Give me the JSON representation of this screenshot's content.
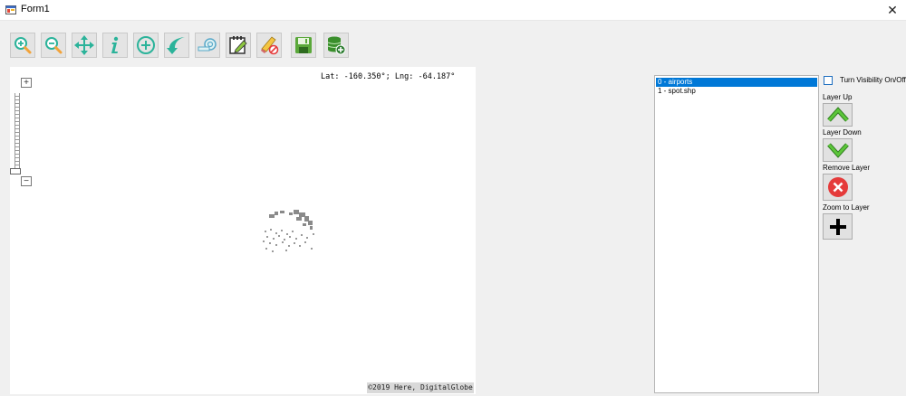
{
  "window": {
    "title": "Form1",
    "close_glyph": "✕",
    "app_icon": "form-app-icon"
  },
  "toolbar": {
    "buttons": [
      {
        "name": "zoom-in",
        "icon": "zoom-in-icon"
      },
      {
        "name": "zoom-out",
        "icon": "zoom-out-icon"
      },
      {
        "name": "pan",
        "icon": "pan-arrows-icon"
      },
      {
        "name": "info",
        "icon": "info-icon"
      },
      {
        "name": "add-layer",
        "icon": "plus-circle-icon"
      },
      {
        "name": "back",
        "icon": "back-arrow-icon"
      },
      {
        "name": "measure",
        "icon": "measure-tape-icon"
      },
      {
        "name": "edit",
        "icon": "edit-pencil-icon"
      },
      {
        "name": "clear",
        "icon": "eraser-icon"
      },
      {
        "name": "save",
        "icon": "floppy-save-icon"
      },
      {
        "name": "database-add",
        "icon": "database-add-icon"
      }
    ]
  },
  "map": {
    "coords_text": "Lat: -160.350°; Lng: -64.187°",
    "attribution": "©2019 Here, DigitalGlobe",
    "zoom_in_glyph": "+",
    "zoom_out_glyph": "−"
  },
  "layers": {
    "items": [
      "0 - airports",
      "1 - spot.shp"
    ],
    "selected_index": 0
  },
  "side": {
    "visibility_label": "Turn Visibility On/Off",
    "visibility_checked": false,
    "layer_up_label": "Layer Up",
    "layer_down_label": "Layer Down",
    "remove_layer_label": "Remove Layer",
    "zoom_to_layer_label": "Zoom to Layer"
  },
  "colors": {
    "accent_teal": "#2bb39a",
    "arrow_green": "#3fa23a",
    "remove_red": "#e53b3b",
    "selection_blue": "#0078d7"
  }
}
